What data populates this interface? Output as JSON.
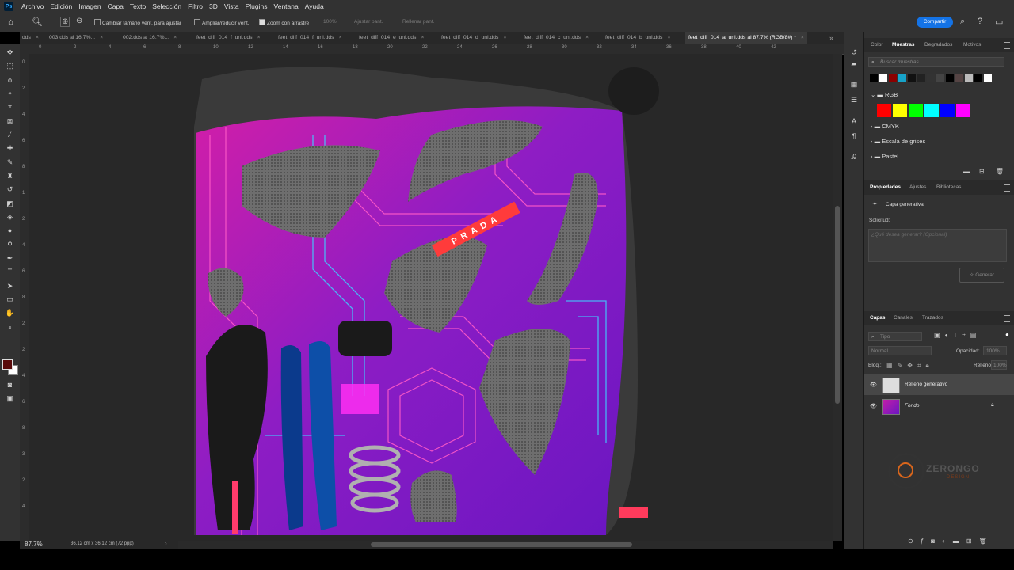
{
  "menu": [
    "Archivo",
    "Edición",
    "Imagen",
    "Capa",
    "Texto",
    "Selección",
    "Filtro",
    "3D",
    "Vista",
    "Plugins",
    "Ventana",
    "Ayuda"
  ],
  "app_logo": "Ps",
  "options": {
    "resize_windows": "Cambiar tamaño vent. para ajustar",
    "zoom_all": "Ampliar/reducir vent.",
    "scrubby_zoom": "Zoom con arrastre",
    "zoom_pct": "100%",
    "fit_screen": "Ajustar pant.",
    "fill_screen": "Rellenar pant.",
    "share": "Compartir"
  },
  "tabs": [
    {
      "label": "dds"
    },
    {
      "label": "003.dds al 16.7%..."
    },
    {
      "label": "002.dds al 16.7%..."
    },
    {
      "label": "feet_diff_014_f_uni.dds"
    },
    {
      "label": "feet_diff_014_f_uni.dds"
    },
    {
      "label": "feet_diff_014_e_uni.dds"
    },
    {
      "label": "feet_diff_014_d_uni.dds"
    },
    {
      "label": "feet_diff_014_c_uni.dds"
    },
    {
      "label": "feet_diff_014_b_uni.dds"
    },
    {
      "label": "feet_diff_014_a_uni.dds al 87.7% (RGB/8#) *"
    }
  ],
  "ruler_h": [
    "0",
    "2",
    "4",
    "6",
    "8",
    "10",
    "12",
    "14",
    "16",
    "18",
    "20",
    "22",
    "24",
    "26",
    "28",
    "30",
    "32",
    "34",
    "36",
    "38",
    "40",
    "42"
  ],
  "ruler_v": [
    "0",
    "2",
    "4",
    "6",
    "8",
    "1",
    "2",
    "4",
    "6",
    "8",
    "2",
    "2",
    "4",
    "6",
    "8",
    "3",
    "2",
    "4"
  ],
  "status": {
    "zoom": "87.7%",
    "doc": "36.12 cm x 36.12 cm (72 ppp)"
  },
  "artwork_text": "PRADA",
  "swatches_panel": {
    "tabs": [
      "Color",
      "Muestras",
      "Degradados",
      "Motivos"
    ],
    "search_placeholder": "Buscar muestras",
    "top_swatches": [
      "#000000",
      "#ffffff",
      "#8b0000",
      "#17a3c9",
      "#111111",
      "#222222",
      "#333333",
      "#444444",
      "#000000",
      "#554444",
      "#bbbbbb",
      "#000000",
      "#ffffff"
    ],
    "rgb_folder": "RGB",
    "rgb_swatches": [
      "#ff0000",
      "#ffff00",
      "#00ff00",
      "#00ffff",
      "#0000ff",
      "#ff00ff"
    ],
    "folders": [
      "CMYK",
      "Escala de grises",
      "Pastel"
    ]
  },
  "properties_panel": {
    "tabs": [
      "Propiedades",
      "Ajustes",
      "Bibliotecas"
    ],
    "layer_type": "Capa generativa",
    "prompt_label": "Solicitud:",
    "prompt_placeholder": "¿Qué desea generar? (Opcional)",
    "generate": "Generar"
  },
  "layers_panel": {
    "tabs": [
      "Capas",
      "Canales",
      "Trazados"
    ],
    "kind_placeholder": "Tipo",
    "blend": "Normal",
    "opacity_label": "Opacidad:",
    "opacity": "100%",
    "lock_label": "Bloq.:",
    "fill_label": "Relleno:",
    "fill": "100%",
    "layers": [
      {
        "name": "Relleno generativo",
        "selected": true
      },
      {
        "name": "Fondo",
        "selected": false
      }
    ]
  },
  "watermark": {
    "brand": "ZERONGO",
    "sub": "DESIGN"
  },
  "colors": {
    "accent": "#1473e6",
    "fg": "#5a0b0b",
    "bg": "#ffffff"
  }
}
